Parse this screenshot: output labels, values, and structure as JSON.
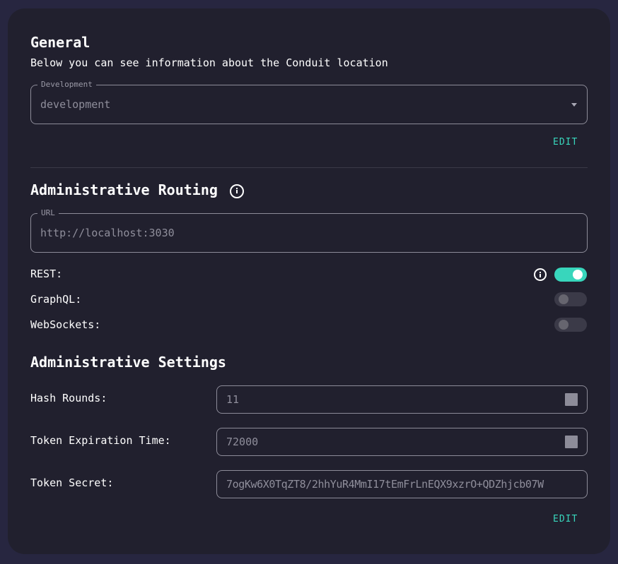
{
  "general": {
    "title": "General",
    "subtitle": "Below you can see information about the Conduit location",
    "environment": {
      "legend": "Development",
      "value": "development",
      "icon": "caret-down-icon"
    },
    "edit_label": "EDIT"
  },
  "routing": {
    "title": "Administrative Routing",
    "title_icon": "info-icon",
    "url": {
      "legend": "URL",
      "value": "http://localhost:3030"
    },
    "toggles": [
      {
        "label": "REST:",
        "enabled": true,
        "has_info": true
      },
      {
        "label": "GraphQL:",
        "enabled": false,
        "has_info": false
      },
      {
        "label": "WebSockets:",
        "enabled": false,
        "has_info": false
      }
    ]
  },
  "settings": {
    "title": "Administrative Settings",
    "hash_rounds": {
      "label": "Hash Rounds:",
      "value": "11"
    },
    "token_expiration": {
      "label": "Token Expiration Time:",
      "value": "72000"
    },
    "token_secret": {
      "label": "Token Secret:",
      "value": "7ogKw6X0TqZT8/2hhYuR4MmI17tEmFrLnEQX9xzrO+QDZhjcb07W"
    },
    "edit_label": "EDIT"
  },
  "colors": {
    "accent": "#38d6bc",
    "card_background": "#21202e",
    "page_background": "#272640"
  }
}
